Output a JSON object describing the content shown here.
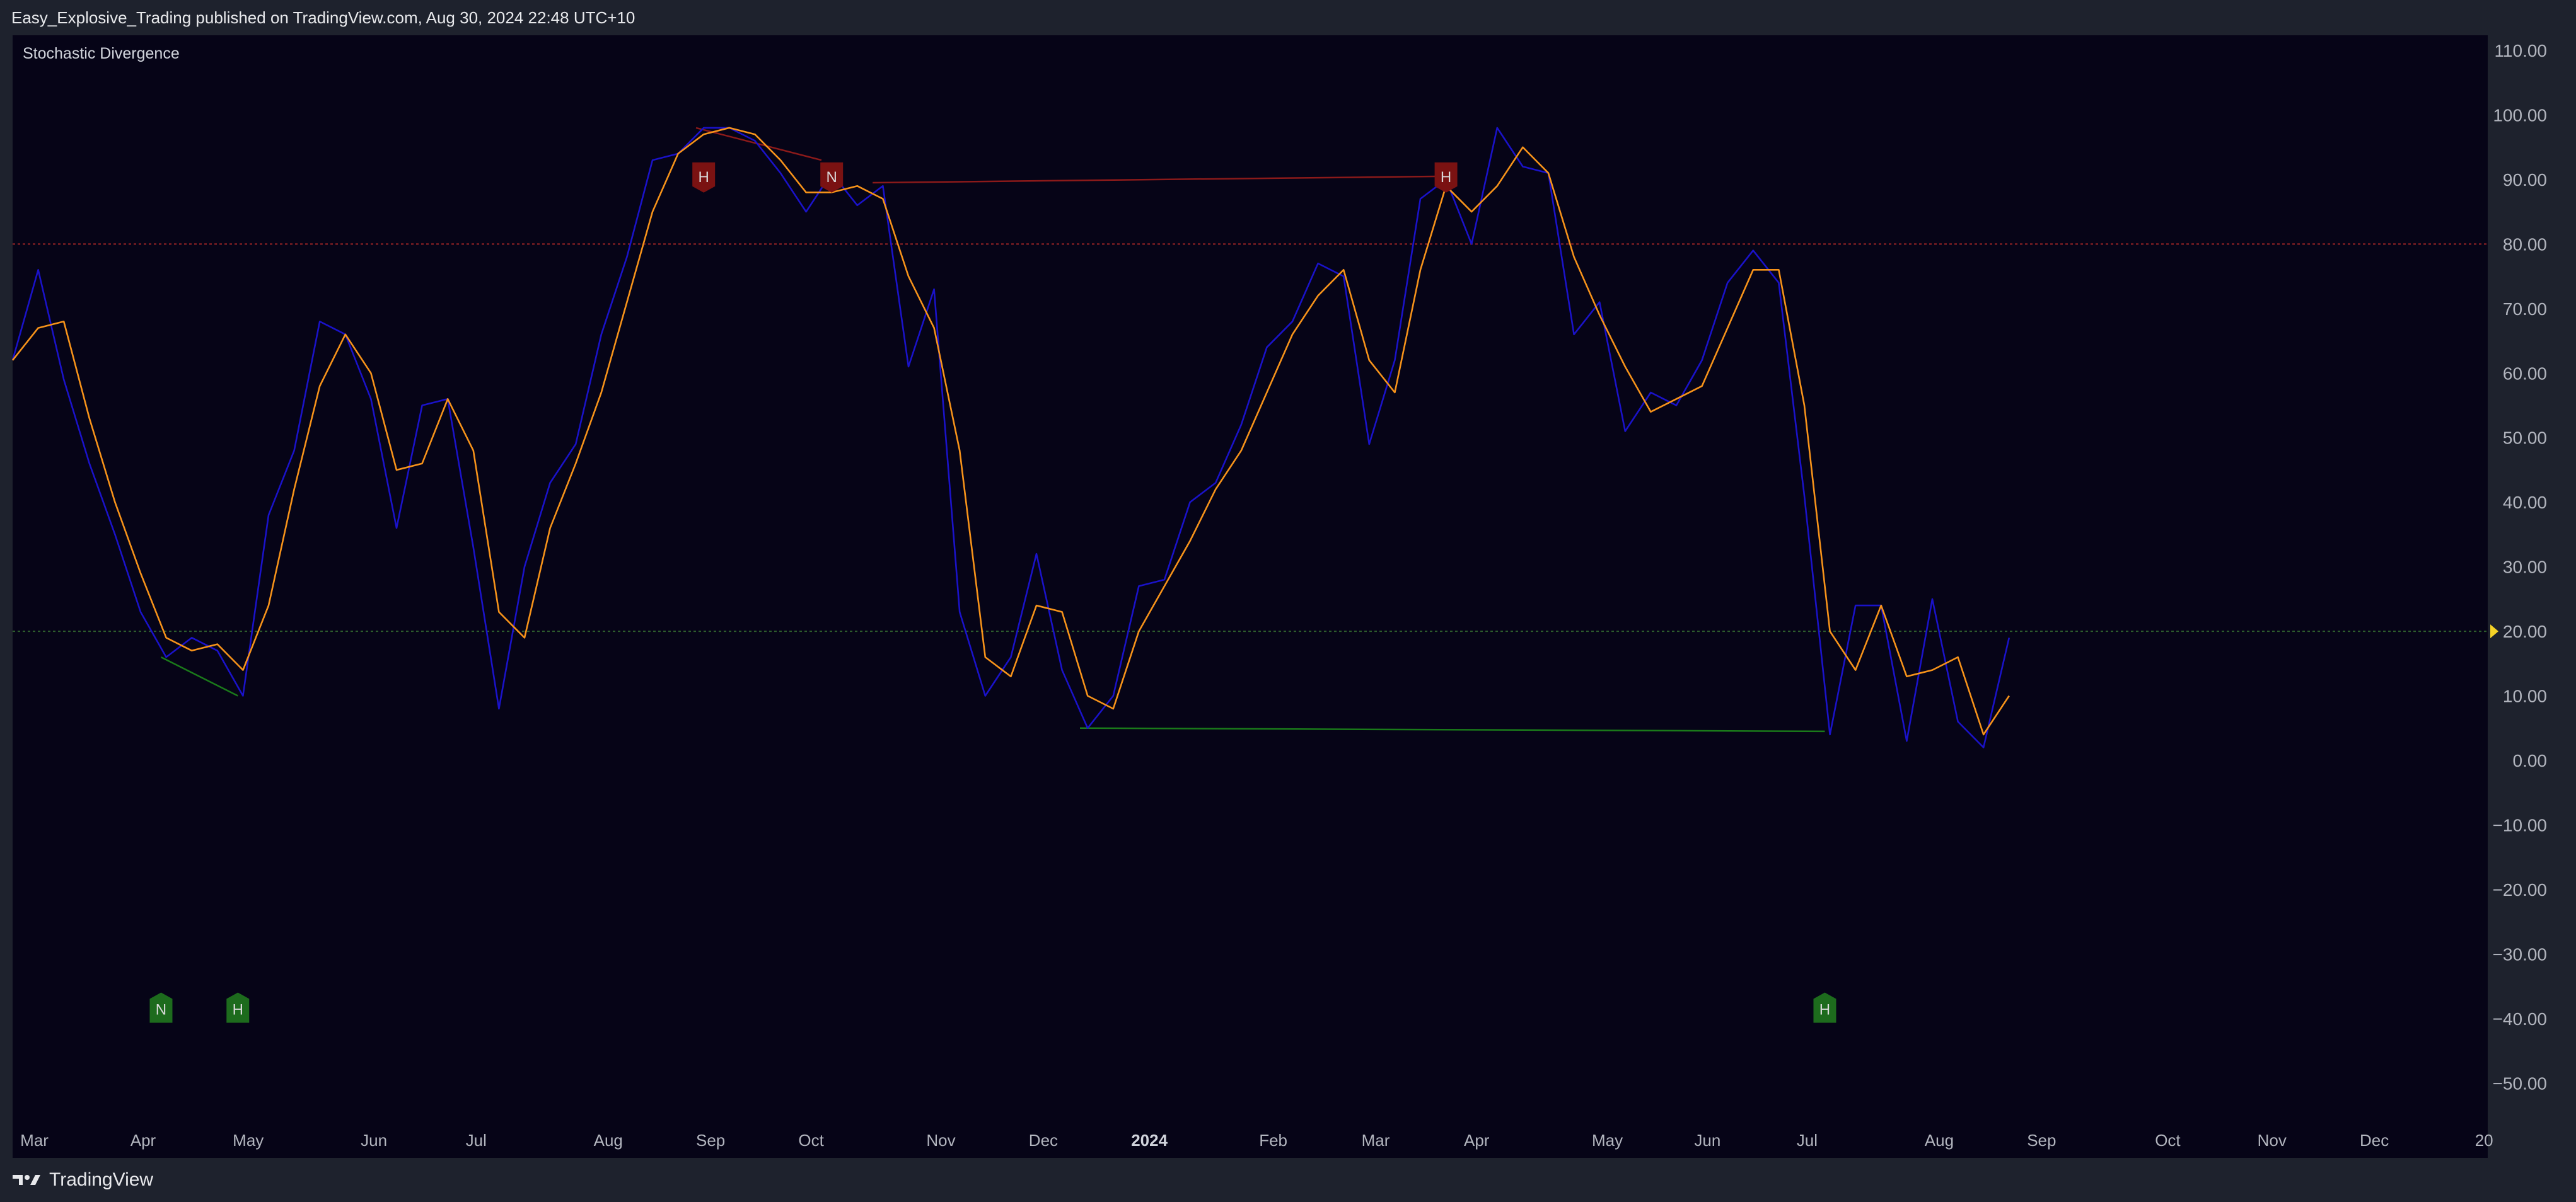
{
  "header": {
    "publisher_text": "Easy_Explosive_Trading published on TradingView.com, Aug 30, 2024 22:48 UTC+10"
  },
  "footer": {
    "brand": "TradingView",
    "logo_icon": "tradingview-logo-icon"
  },
  "colors": {
    "background": "#060417",
    "frame": "#1e222d",
    "k_line": "#1a12c9",
    "d_line": "#f7931a",
    "bear_divergence": "#8b1a1a",
    "bull_divergence": "#1a7a1a",
    "overbought_line": "#9c2525",
    "oversold_line": "#2d5d2d",
    "price_marker": "#f5d327"
  },
  "chart_data": {
    "type": "line",
    "title": "Stochastic Divergence",
    "ylim": [
      -55,
      112
    ],
    "y_ticks": [
      "110.00",
      "100.00",
      "90.00",
      "80.00",
      "70.00",
      "60.00",
      "50.00",
      "40.00",
      "30.00",
      "20.00",
      "10.00",
      "0.00",
      "−10.00",
      "−20.00",
      "−30.00",
      "−40.00",
      "−50.00"
    ],
    "y_tick_values": [
      110,
      100,
      90,
      80,
      70,
      60,
      50,
      40,
      30,
      20,
      10,
      0,
      -10,
      -20,
      -30,
      -40,
      -50
    ],
    "x_ticks": [
      {
        "label": "Mar",
        "x": 0.3,
        "bold": false
      },
      {
        "label": "Apr",
        "x": 4.6,
        "bold": false
      },
      {
        "label": "May",
        "x": 8.6,
        "bold": false
      },
      {
        "label": "Jun",
        "x": 13.6,
        "bold": false
      },
      {
        "label": "Jul",
        "x": 17.7,
        "bold": false
      },
      {
        "label": "Aug",
        "x": 22.7,
        "bold": false
      },
      {
        "label": "Sep",
        "x": 26.7,
        "bold": false
      },
      {
        "label": "Oct",
        "x": 30.7,
        "bold": false
      },
      {
        "label": "Nov",
        "x": 35.7,
        "bold": false
      },
      {
        "label": "Dec",
        "x": 39.7,
        "bold": false
      },
      {
        "label": "2024",
        "x": 43.7,
        "bold": true
      },
      {
        "label": "Feb",
        "x": 48.7,
        "bold": false
      },
      {
        "label": "Mar",
        "x": 52.7,
        "bold": false
      },
      {
        "label": "Apr",
        "x": 56.7,
        "bold": false
      },
      {
        "label": "May",
        "x": 61.7,
        "bold": false
      },
      {
        "label": "Jun",
        "x": 65.7,
        "bold": false
      },
      {
        "label": "Jul",
        "x": 69.7,
        "bold": false
      },
      {
        "label": "Aug",
        "x": 74.7,
        "bold": false
      },
      {
        "label": "Sep",
        "x": 78.7,
        "bold": false
      },
      {
        "label": "Oct",
        "x": 83.7,
        "bold": false
      },
      {
        "label": "Nov",
        "x": 87.7,
        "bold": false
      },
      {
        "label": "Dec",
        "x": 91.7,
        "bold": false
      },
      {
        "label": "20",
        "x": 96.2,
        "bold": false
      }
    ],
    "x_range": [
      0,
      96.7
    ],
    "overbought": 80,
    "oversold": 20,
    "last_value": 20,
    "series": [
      {
        "name": "%K",
        "color": "#1a12c9",
        "values": [
          [
            0,
            62
          ],
          [
            1,
            76
          ],
          [
            2,
            59
          ],
          [
            3,
            46
          ],
          [
            4,
            35
          ],
          [
            5,
            23
          ],
          [
            6,
            16
          ],
          [
            7,
            19
          ],
          [
            8,
            17
          ],
          [
            9,
            10
          ],
          [
            10,
            38
          ],
          [
            11,
            48
          ],
          [
            12,
            68
          ],
          [
            13,
            66
          ],
          [
            14,
            56
          ],
          [
            15,
            36
          ],
          [
            16,
            55
          ],
          [
            17,
            56
          ],
          [
            18,
            33
          ],
          [
            19,
            8
          ],
          [
            20,
            30
          ],
          [
            21,
            43
          ],
          [
            22,
            49
          ],
          [
            23,
            66
          ],
          [
            24,
            78
          ],
          [
            25,
            93
          ],
          [
            26,
            94
          ],
          [
            27,
            98
          ],
          [
            28,
            98
          ],
          [
            29,
            96
          ],
          [
            30,
            91
          ],
          [
            31,
            85
          ],
          [
            32,
            91
          ],
          [
            33,
            86
          ],
          [
            34,
            89
          ],
          [
            35,
            61
          ],
          [
            36,
            73
          ],
          [
            37,
            23
          ],
          [
            38,
            10
          ],
          [
            39,
            16
          ],
          [
            40,
            32
          ],
          [
            41,
            14
          ],
          [
            42,
            5
          ],
          [
            43,
            10
          ],
          [
            44,
            27
          ],
          [
            45,
            28
          ],
          [
            46,
            40
          ],
          [
            47,
            43
          ],
          [
            48,
            52
          ],
          [
            49,
            64
          ],
          [
            50,
            68
          ],
          [
            51,
            77
          ],
          [
            52,
            75
          ],
          [
            53,
            49
          ],
          [
            54,
            62
          ],
          [
            55,
            87
          ],
          [
            56,
            90
          ],
          [
            57,
            80
          ],
          [
            58,
            98
          ],
          [
            59,
            92
          ],
          [
            60,
            91
          ],
          [
            61,
            66
          ],
          [
            62,
            71
          ],
          [
            63,
            51
          ],
          [
            64,
            57
          ],
          [
            65,
            55
          ],
          [
            66,
            62
          ],
          [
            67,
            74
          ],
          [
            68,
            79
          ],
          [
            69,
            74
          ],
          [
            70,
            41
          ],
          [
            71,
            4
          ],
          [
            72,
            24
          ],
          [
            73,
            24
          ],
          [
            74,
            3
          ],
          [
            75,
            25
          ],
          [
            76,
            6
          ],
          [
            77,
            2
          ],
          [
            78,
            19
          ]
        ]
      },
      {
        "name": "%D",
        "color": "#f7931a",
        "values": [
          [
            0,
            62
          ],
          [
            1,
            67
          ],
          [
            2,
            68
          ],
          [
            3,
            53
          ],
          [
            4,
            40
          ],
          [
            5,
            29
          ],
          [
            6,
            19
          ],
          [
            7,
            17
          ],
          [
            8,
            18
          ],
          [
            9,
            14
          ],
          [
            10,
            24
          ],
          [
            11,
            42
          ],
          [
            12,
            58
          ],
          [
            13,
            66
          ],
          [
            14,
            60
          ],
          [
            15,
            45
          ],
          [
            16,
            46
          ],
          [
            17,
            56
          ],
          [
            18,
            48
          ],
          [
            19,
            23
          ],
          [
            20,
            19
          ],
          [
            21,
            36
          ],
          [
            22,
            46
          ],
          [
            23,
            57
          ],
          [
            24,
            71
          ],
          [
            25,
            85
          ],
          [
            26,
            94
          ],
          [
            27,
            97
          ],
          [
            28,
            98
          ],
          [
            29,
            97
          ],
          [
            30,
            93
          ],
          [
            31,
            88
          ],
          [
            32,
            88
          ],
          [
            33,
            89
          ],
          [
            34,
            87
          ],
          [
            35,
            75
          ],
          [
            36,
            67
          ],
          [
            37,
            48
          ],
          [
            38,
            16
          ],
          [
            39,
            13
          ],
          [
            40,
            24
          ],
          [
            41,
            23
          ],
          [
            42,
            10
          ],
          [
            43,
            8
          ],
          [
            44,
            20
          ],
          [
            45,
            27
          ],
          [
            46,
            34
          ],
          [
            47,
            42
          ],
          [
            48,
            48
          ],
          [
            49,
            57
          ],
          [
            50,
            66
          ],
          [
            51,
            72
          ],
          [
            52,
            76
          ],
          [
            53,
            62
          ],
          [
            54,
            57
          ],
          [
            55,
            76
          ],
          [
            56,
            89
          ],
          [
            57,
            85
          ],
          [
            58,
            89
          ],
          [
            59,
            95
          ],
          [
            60,
            91
          ],
          [
            61,
            78
          ],
          [
            62,
            69
          ],
          [
            63,
            61
          ],
          [
            64,
            54
          ],
          [
            65,
            56
          ],
          [
            66,
            58
          ],
          [
            67,
            67
          ],
          [
            68,
            76
          ],
          [
            69,
            76
          ],
          [
            70,
            55
          ],
          [
            71,
            20
          ],
          [
            72,
            14
          ],
          [
            73,
            24
          ],
          [
            74,
            13
          ],
          [
            75,
            14
          ],
          [
            76,
            16
          ],
          [
            77,
            4
          ],
          [
            78,
            10
          ]
        ]
      }
    ],
    "divergence_lines": [
      {
        "kind": "bull",
        "from": [
          5.8,
          16
        ],
        "to": [
          8.8,
          10
        ]
      },
      {
        "kind": "bear",
        "from": [
          26.7,
          98
        ],
        "to": [
          31.6,
          93
        ]
      },
      {
        "kind": "bear",
        "from": [
          33.6,
          89.5
        ],
        "to": [
          56.1,
          90.5
        ]
      },
      {
        "kind": "bull",
        "from": [
          41.7,
          5
        ],
        "to": [
          70.8,
          4.5
        ]
      }
    ],
    "markers": [
      {
        "label": "H",
        "kind": "bear",
        "x": 27,
        "y": 90.5
      },
      {
        "label": "N",
        "kind": "bear",
        "x": 32,
        "y": 90.5
      },
      {
        "label": "H",
        "kind": "bear",
        "x": 56,
        "y": 90.5
      },
      {
        "label": "N",
        "kind": "bull",
        "x": 5.8,
        "y": -38.5
      },
      {
        "label": "H",
        "kind": "bull",
        "x": 8.8,
        "y": -38.5
      },
      {
        "label": "H",
        "kind": "bull",
        "x": 70.8,
        "y": -38.5
      }
    ]
  }
}
